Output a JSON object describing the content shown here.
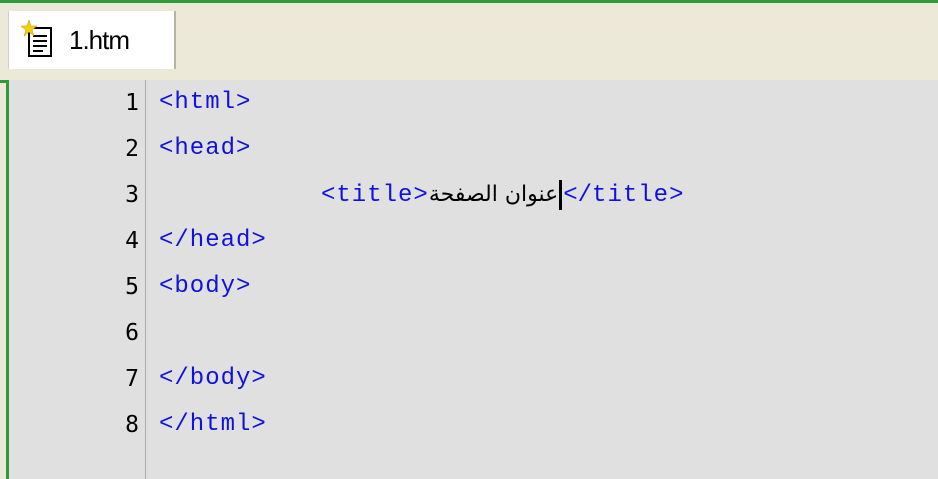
{
  "tab": {
    "label": "1.htm",
    "icon": "new-html-file-icon"
  },
  "colors": {
    "accent": "#2e9a3a",
    "tag": "#1010e0",
    "editor_bg": "#e0e0e0"
  },
  "lines": [
    {
      "num": "1",
      "code": "<html>"
    },
    {
      "num": "2",
      "code": "<head>"
    },
    {
      "num": "3",
      "code_open": "<title>",
      "text": "عنوان الصفحة",
      "code_close": "</title>"
    },
    {
      "num": "4",
      "code": "</head>"
    },
    {
      "num": "5",
      "code": "<body>"
    },
    {
      "num": "6",
      "code": ""
    },
    {
      "num": "7",
      "code": "</body>"
    },
    {
      "num": "8",
      "code": "</html>"
    }
  ]
}
